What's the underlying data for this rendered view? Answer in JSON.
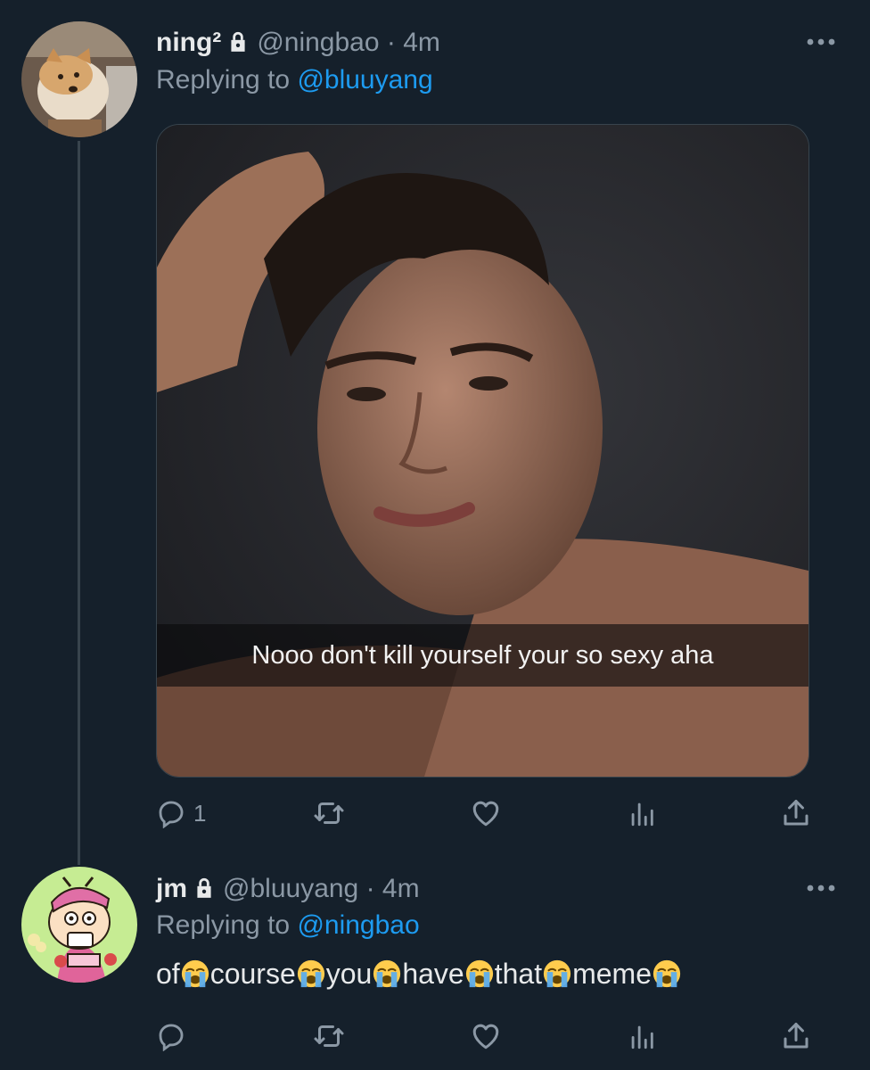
{
  "tweets": [
    {
      "name": "ning²",
      "handle": "@ningbao",
      "time": "· 4m",
      "reply_prefix": "Replying to",
      "reply_to": "@bluuyang",
      "media_caption": "Nooo don't kill yourself your so sexy aha",
      "reply_count": "1"
    },
    {
      "name": "jm",
      "handle": "@bluuyang",
      "time": "· 4m",
      "reply_prefix": "Replying to",
      "reply_to": "@ningbao",
      "words": [
        "of",
        "course",
        "you",
        "have",
        "that",
        "meme"
      ]
    }
  ],
  "colors": {
    "background": "#15202b",
    "accent": "#1d9bf0",
    "muted": "#8b98a5",
    "text": "#e7e9ea"
  },
  "icons": [
    "lock-icon",
    "more-icon",
    "reply-icon",
    "retweet-icon",
    "like-icon",
    "analytics-icon",
    "share-icon",
    "loudly-crying-emoji"
  ]
}
